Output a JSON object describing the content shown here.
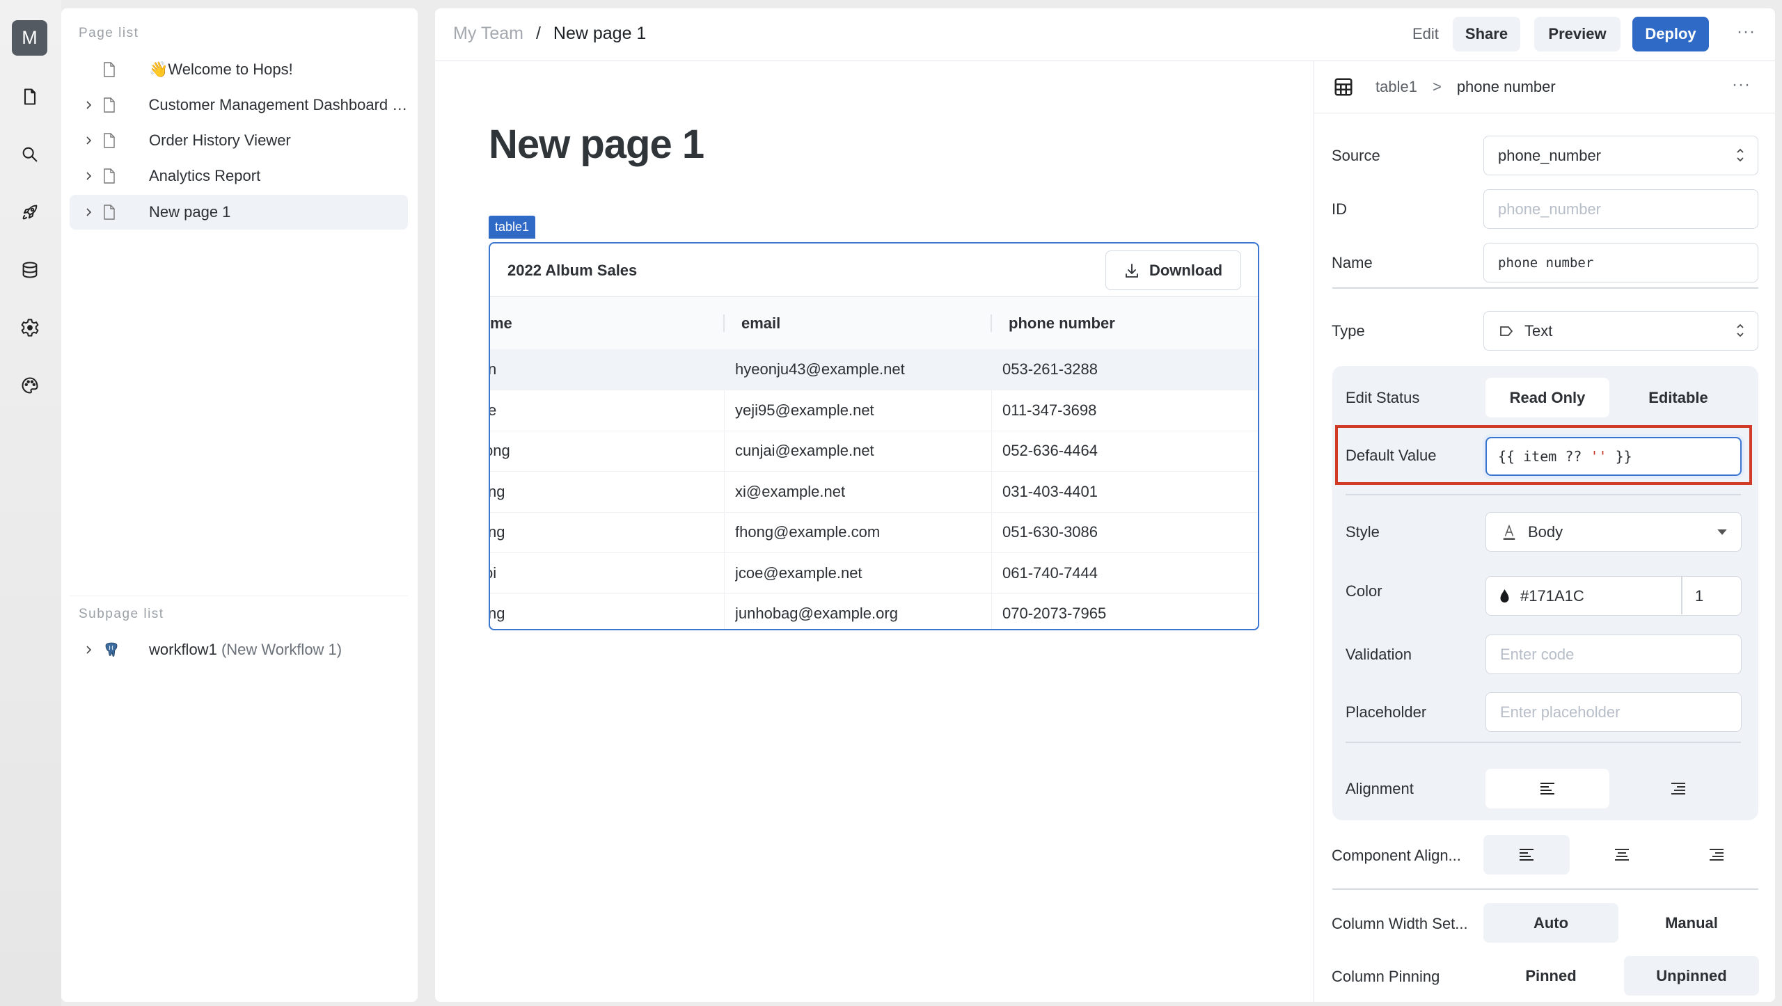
{
  "rail": {
    "avatar_letter": "M",
    "icons": [
      "file-icon",
      "search-icon",
      "rocket-icon",
      "database-icon",
      "gear-icon",
      "palette-icon"
    ]
  },
  "sidebar": {
    "page_list_title": "Page list",
    "pages": [
      {
        "emoji": "👋",
        "label": "Welcome to Hops!",
        "expandable": false,
        "active": false
      },
      {
        "emoji": "",
        "label": "Customer Management Dashboard -...",
        "expandable": true,
        "active": false
      },
      {
        "emoji": "",
        "label": "Order History Viewer",
        "expandable": true,
        "active": false
      },
      {
        "emoji": "",
        "label": "Analytics Report",
        "expandable": true,
        "active": false
      },
      {
        "emoji": "",
        "label": "New page 1",
        "expandable": true,
        "active": true
      }
    ],
    "subpage_list_title": "Subpage list",
    "subpages": [
      {
        "name": "workflow1",
        "detail": "(New Workflow 1)",
        "icon": "postgres-elephant-icon"
      }
    ]
  },
  "header": {
    "breadcrumb": {
      "team": "My Team",
      "separator": "/",
      "page": "New page 1"
    },
    "edit_label": "Edit",
    "share_label": "Share",
    "preview_label": "Preview",
    "deploy_label": "Deploy",
    "more_label": "···"
  },
  "canvas": {
    "page_title": "New page 1",
    "component_tag": "table1",
    "table": {
      "title": "2022 Album Sales",
      "download_label": "Download",
      "columns": [
        "me",
        "email",
        "phone number"
      ],
      "rows": [
        {
          "name": "n",
          "email": "hyeonju43@example.net",
          "phone": "053-261-3288"
        },
        {
          "name": "e",
          "email": "yeji95@example.net",
          "phone": "011-347-3698"
        },
        {
          "name": "ong",
          "email": "cunjai@example.net",
          "phone": "052-636-4464"
        },
        {
          "name": "ng",
          "email": "xi@example.net",
          "phone": "031-403-4401"
        },
        {
          "name": "ng",
          "email": "fhong@example.com",
          "phone": "051-630-3086"
        },
        {
          "name": "oi",
          "email": "jcoe@example.net",
          "phone": "061-740-7444"
        },
        {
          "name": "ng",
          "email": "junhobag@example.org",
          "phone": "070-2073-7965"
        }
      ]
    }
  },
  "props": {
    "breadcrumb": {
      "parent": "table1",
      "separator": ">",
      "current": "phone number"
    },
    "more_label": "···",
    "source": {
      "label": "Source",
      "value": "phone_number"
    },
    "id": {
      "label": "ID",
      "placeholder": "phone_number"
    },
    "name": {
      "label": "Name",
      "value": "phone number"
    },
    "type": {
      "label": "Type",
      "value": "Text"
    },
    "edit_status": {
      "label": "Edit Status",
      "options": [
        "Read Only",
        "Editable"
      ],
      "selected": "Read Only"
    },
    "default_value": {
      "label": "Default Value",
      "prefix": "{{ item ?? ",
      "string": "''",
      "suffix": " }}"
    },
    "style": {
      "label": "Style",
      "value": "Body"
    },
    "color": {
      "label": "Color",
      "hex": "#171A1C",
      "opacity": "1"
    },
    "validation": {
      "label": "Validation",
      "placeholder": "Enter code"
    },
    "placeholder": {
      "label": "Placeholder",
      "placeholder": "Enter placeholder"
    },
    "alignment": {
      "label": "Alignment",
      "options": [
        "left",
        "right"
      ],
      "selected": "left"
    },
    "component_alignment": {
      "label": "Component Align...",
      "options": [
        "left",
        "center",
        "right"
      ],
      "selected": "left"
    },
    "column_width": {
      "label": "Column Width Set...",
      "options": [
        "Auto",
        "Manual"
      ],
      "selected": "Auto"
    },
    "column_pinning": {
      "label": "Column Pinning",
      "options": [
        "Pinned",
        "Unpinned"
      ],
      "selected": "Unpinned"
    }
  },
  "colors": {
    "accent": "#2f6bc6",
    "highlight_box": "#d13a26",
    "text_color_value": "#171A1C"
  }
}
